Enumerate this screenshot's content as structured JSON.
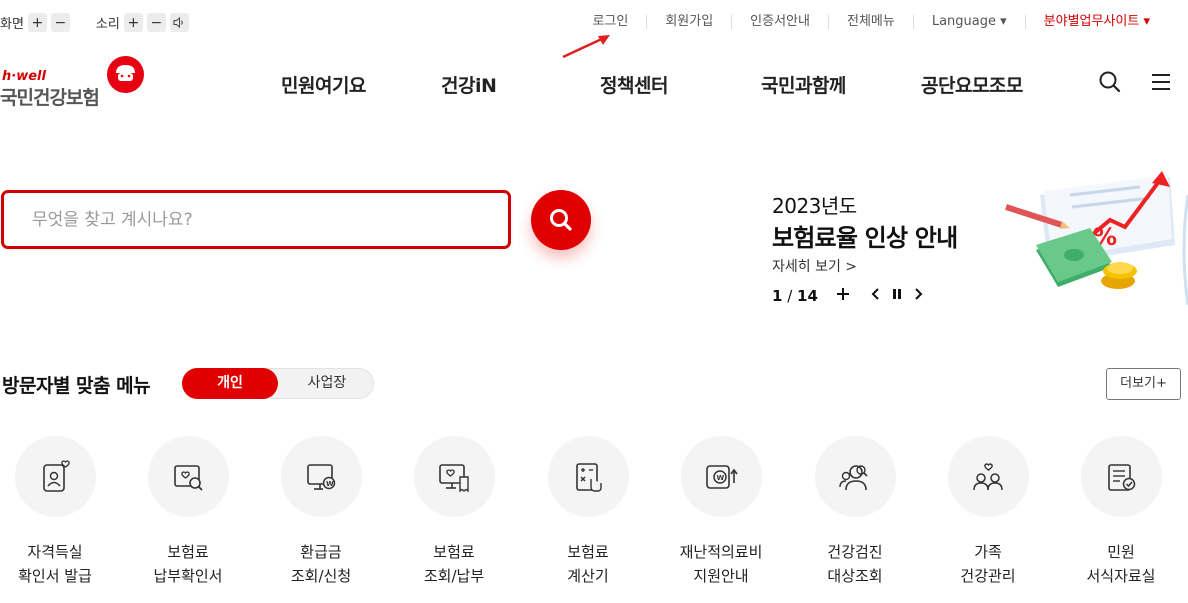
{
  "utility_left": {
    "screen_label": "화면",
    "sound_label": "소리",
    "plus": "+",
    "minus": "−"
  },
  "utility_right": {
    "login": "로그인",
    "signup": "회원가입",
    "cert": "인증서안내",
    "all_menu": "전체메뉴",
    "language": "Language ▾",
    "field_site": "분야별업무사이트 ▾"
  },
  "logo": {
    "brand_small": "h·well",
    "brand_main": "국민건강보험"
  },
  "gnb": {
    "items": [
      "민원여기요",
      "건강iN",
      "정책센터",
      "국민과함께",
      "공단요모조모"
    ]
  },
  "search": {
    "placeholder": "무엇을 찾고 계시나요?"
  },
  "banner": {
    "year": "2023년도",
    "title": "보험료율 인상 안내",
    "more": "자세히 보기 >",
    "current_page": "1",
    "separator": " / ",
    "total_pages": "14"
  },
  "visitor_menu": {
    "title": "방문자별 맞춤 메뉴",
    "tab_personal": "개인",
    "tab_business": "사업장",
    "more": "더보기+",
    "items": [
      {
        "label": "자격득실\n확인서 발급"
      },
      {
        "label": "보험료\n납부확인서"
      },
      {
        "label": "환급금\n조회/신청"
      },
      {
        "label": "보험료\n조회/납부"
      },
      {
        "label": "보험료\n계산기"
      },
      {
        "label": "재난적의료비\n지원안내"
      },
      {
        "label": "건강검진\n대상조회"
      },
      {
        "label": "가족\n건강관리"
      },
      {
        "label": "민원\n서식자료실"
      }
    ]
  },
  "colors": {
    "brand_red": "#e00000",
    "text_dark": "#222222",
    "circle_bg": "#f4f4f4"
  }
}
